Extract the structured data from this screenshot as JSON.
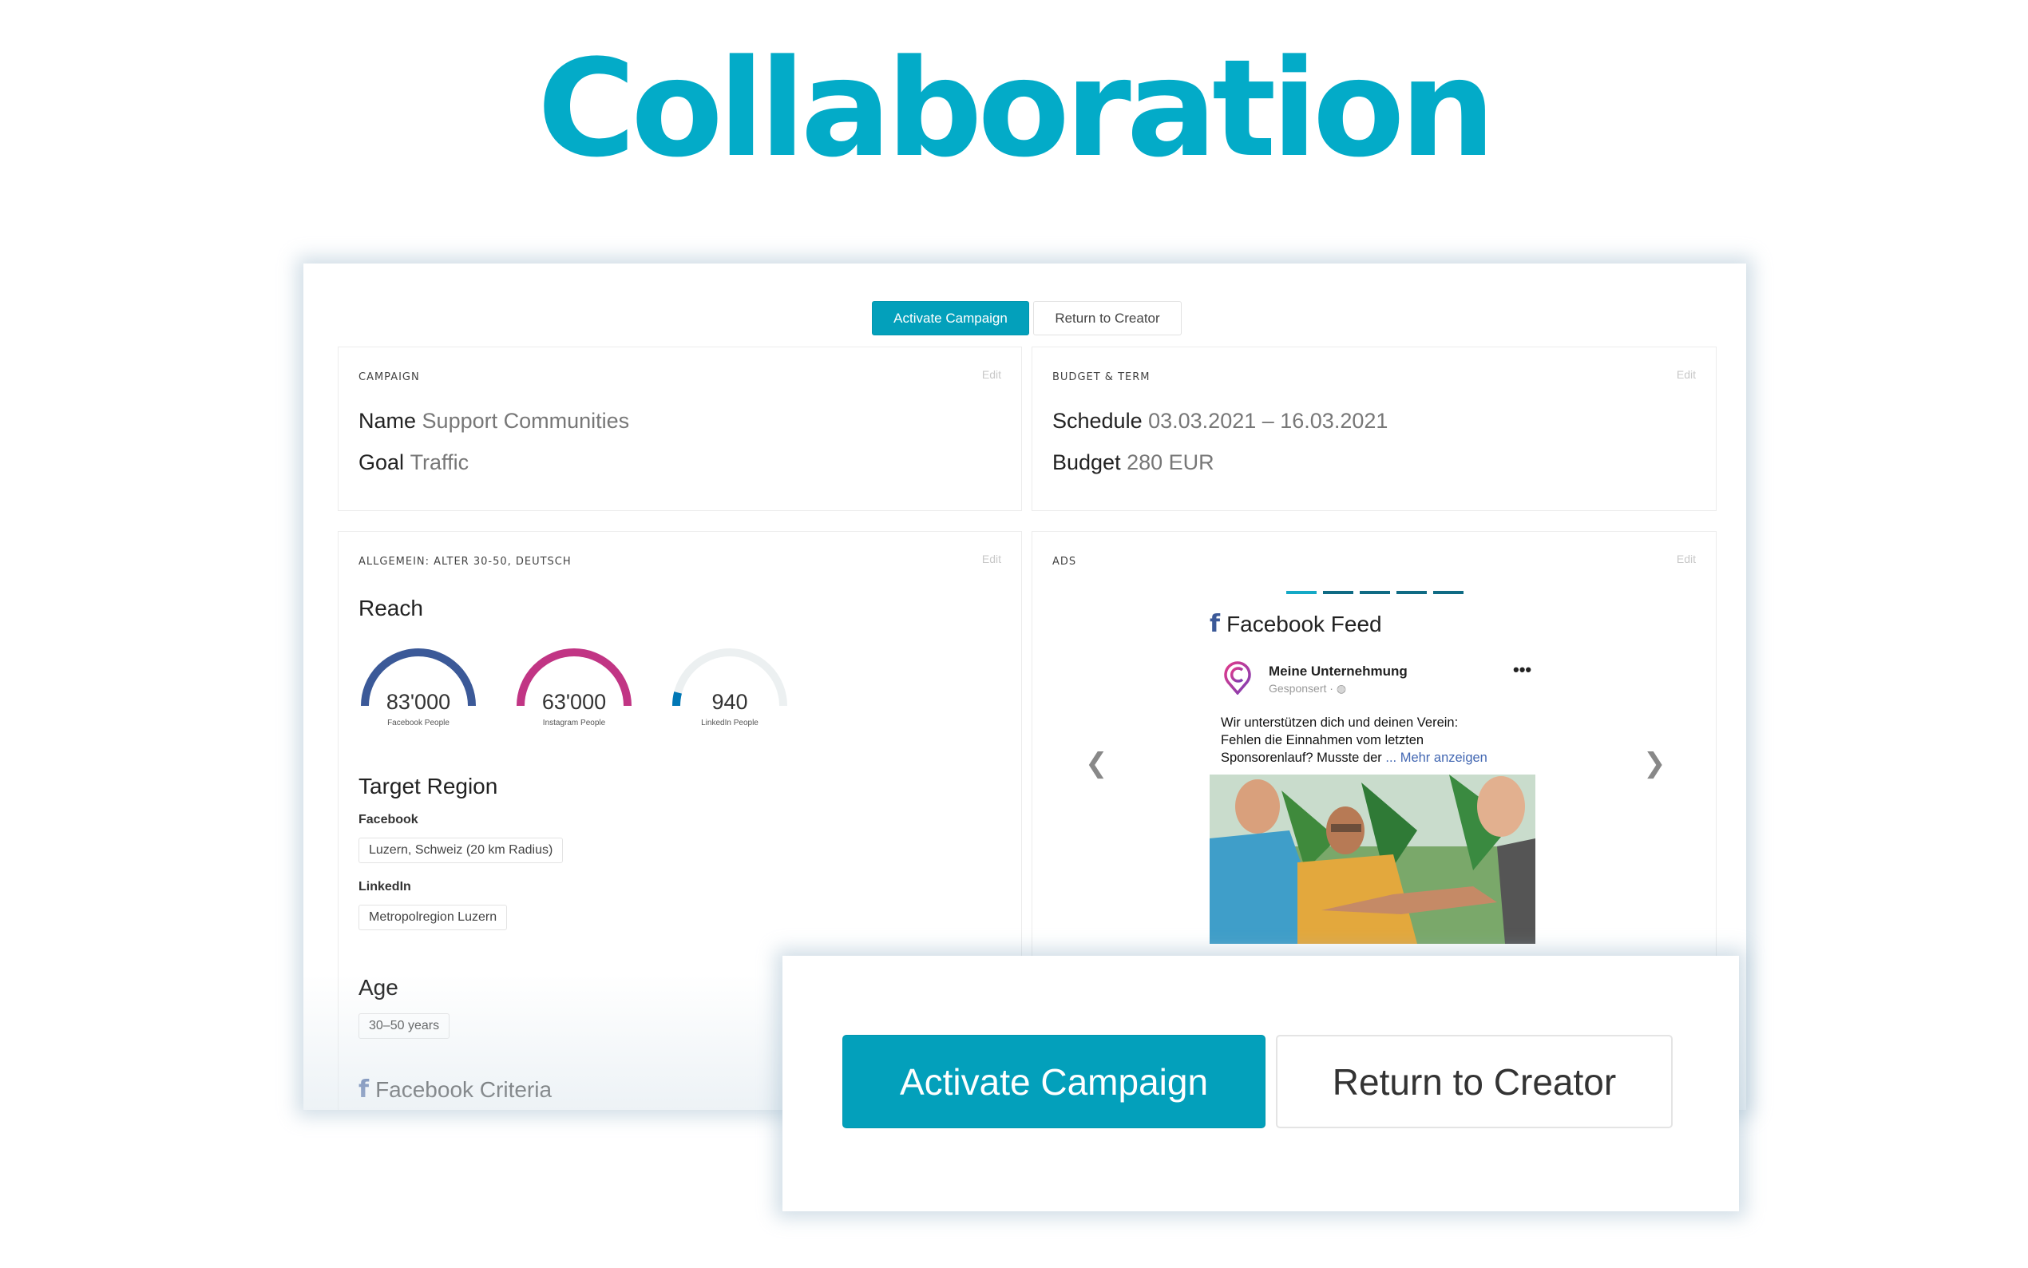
{
  "hero": {
    "title": "Collaboration"
  },
  "colors": {
    "accent": "#03abc8",
    "primary_button": "#03a0bb",
    "facebook": "#3b5998",
    "instagram": "#c13584",
    "linkedin": "#0077b5",
    "gauge_track": "#ecf0f1"
  },
  "toolbar": {
    "activate_label": "Activate Campaign",
    "return_label": "Return to Creator"
  },
  "campaign": {
    "label": "CAMPAIGN",
    "edit": "Edit",
    "fields": [
      {
        "key": "Name",
        "value": "Support Communities"
      },
      {
        "key": "Goal",
        "value": "Traffic"
      }
    ]
  },
  "budget": {
    "label": "BUDGET & TERM",
    "edit": "Edit",
    "fields": [
      {
        "key": "Schedule",
        "value": "03.03.2021 – 16.03.2021"
      },
      {
        "key": "Budget",
        "value": "280 EUR"
      }
    ]
  },
  "targeting": {
    "label": "ALLGEMEIN: ALTER 30-50, DEUTSCH",
    "edit": "Edit",
    "reach_title": "Reach",
    "reach": [
      {
        "value": "83'000",
        "label": "Facebook People",
        "fill": 1.0,
        "color": "#3b5998"
      },
      {
        "value": "63'000",
        "label": "Instagram People",
        "fill": 1.0,
        "color": "#c13584"
      },
      {
        "value": "940",
        "label": "LinkedIn People",
        "fill": 0.08,
        "color": "#0077b5"
      }
    ],
    "region_title": "Target Region",
    "regions": [
      {
        "platform": "Facebook",
        "value": "Luzern, Schweiz (20 km Radius)"
      },
      {
        "platform": "LinkedIn",
        "value": "Metropolregion Luzern"
      }
    ],
    "age_title": "Age",
    "age_value": "30–50 years",
    "fb_criteria_title": "Facebook Criteria",
    "fb_icon": "f"
  },
  "ads": {
    "label": "ADS",
    "edit": "Edit",
    "slides_total": 5,
    "slide_active": 1,
    "feed_title": "Facebook Feed",
    "fb_icon": "f",
    "post": {
      "page_name": "Meine Unternehmung",
      "meta": "Gesponsert · ◍",
      "more_icon": "•••",
      "text_lines": [
        "Wir unterstützen dich und deinen Verein:",
        "Fehlen die Einnahmen vom letzten",
        "Sponsorenlauf? Musste der "
      ],
      "more_link": "... Mehr anzeigen"
    },
    "prev_icon": "❮",
    "next_icon": "❯"
  },
  "overlay": {
    "activate_label": "Activate Campaign",
    "return_label": "Return to Creator"
  }
}
